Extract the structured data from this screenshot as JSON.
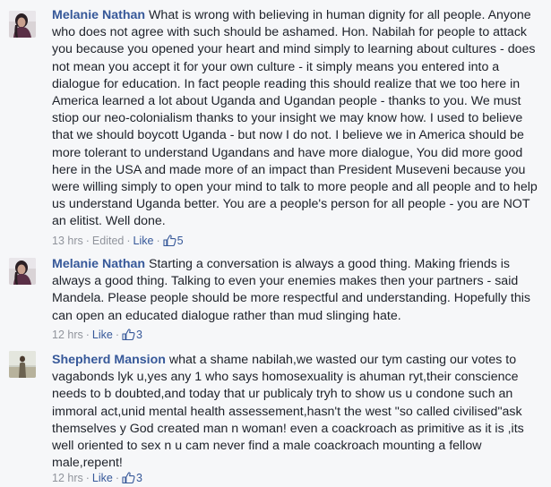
{
  "comments": [
    {
      "author": "Melanie Nathan",
      "text": "What is wrong with believing in human dignity for all people. Anyone who does not agree with such should be ashamed. Hon. Nabilah for people to attack you because you opened your heart and mind simply to learning about cultures - does not mean you accept it for your own culture - it simply means you entered into a dialogue for education. In fact people reading this should realize that we too here in America learned a lot about Uganda and Ugandan people - thanks to you. We must stiop our neo-colonialism thanks to your insight we may know how. I used to believe that we should boycott Uganda - but now I do not. I believe we in America should be more tolerant to understand Ugandans and have more dialogue, You did more good here in the USA and made more of an impact than President Museveni because you were willing simply to open your mind to talk to more people and all people and to help us understand Uganda better. You are a people's person for all people - you are NOT an elitist. Well done.",
      "time": "13 hrs",
      "edited": "Edited",
      "like_label": "Like",
      "like_count": "5"
    },
    {
      "author": "Melanie Nathan",
      "text": "Starting a conversation is always a good thing. Making friends is always a good thing. Talking to even your enemies makes then your partners - said Mandela. Please people should be more respectful and understanding. Hopefully this can open an educated dialogue rather than mud slinging hate.",
      "time": "12 hrs",
      "like_label": "Like",
      "like_count": "3"
    },
    {
      "author": "Shepherd Mansion",
      "text": "what a shame nabilah,we wasted our tym casting our votes to vagabonds lyk u,yes any 1 who says homosexuality is ahuman ryt,their conscience needs to b doubted,and today that ur publicaly tryh to show us u condone such an immoral act,unid mental health assessement,hasn't the west \"so called civilised\"ask themselves y God created man n woman! even a coackroach as primitive as it is ,its well oriented to sex n u cam never find a male coackroach mounting a fellow male,repent!",
      "time": "12 hrs",
      "like_label": "Like",
      "like_count": "3"
    }
  ],
  "colors": {
    "author": "#365899",
    "meta": "#90949c",
    "text": "#1d2129",
    "background": "#f6f7f9"
  },
  "icons": {
    "like": "thumbs-up-icon"
  }
}
